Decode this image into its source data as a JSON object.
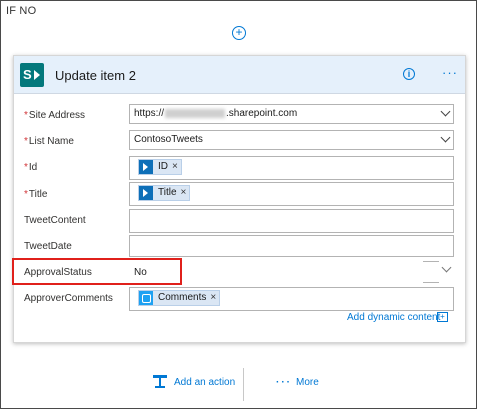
{
  "branch": {
    "label": "IF NO"
  },
  "add_step": {
    "glyph": "+"
  },
  "card": {
    "title": "Update item 2",
    "info_glyph": "i",
    "more_glyph": "···",
    "accent_color": "#e5f0fb",
    "connector_icon": "sharepoint-icon"
  },
  "fields": {
    "site_address": {
      "label": "Site Address",
      "required": "*",
      "value_prefix": "https://",
      "value_suffix": ".sharepoint.com"
    },
    "list_name": {
      "label": "List Name",
      "required": "*",
      "value": "ContosoTweets"
    },
    "id": {
      "label": "Id",
      "required": "*",
      "token": "ID",
      "token_icon": "sharepoint-icon"
    },
    "title": {
      "label": "Title",
      "required": "*",
      "token": "Title",
      "token_icon": "sharepoint-icon"
    },
    "tweet_content": {
      "label": "TweetContent",
      "value": ""
    },
    "tweet_date": {
      "label": "TweetDate",
      "value": ""
    },
    "approval_status": {
      "label": "ApprovalStatus",
      "value": "No",
      "highlight_color": "#e0201b"
    },
    "approver_comments": {
      "label": "ApproverComments",
      "token": "Comments",
      "token_icon": "approval-icon"
    }
  },
  "token_remove_glyph": "×",
  "dynamic_content": {
    "label": "Add dynamic content",
    "icon": "add-dynamic-content-icon"
  },
  "footer": {
    "add_action_label": "Add an action",
    "more_label": "More",
    "more_dots": "···"
  }
}
